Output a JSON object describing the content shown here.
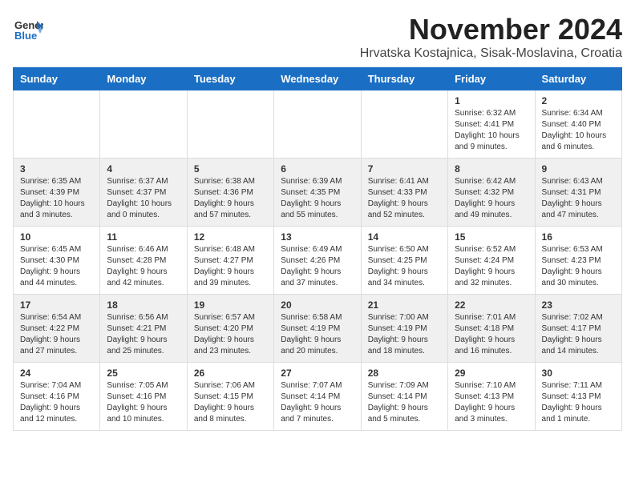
{
  "header": {
    "logo_general": "General",
    "logo_blue": "Blue",
    "month_title": "November 2024",
    "location": "Hrvatska Kostajnica, Sisak-Moslavina, Croatia"
  },
  "weekdays": [
    "Sunday",
    "Monday",
    "Tuesday",
    "Wednesday",
    "Thursday",
    "Friday",
    "Saturday"
  ],
  "weeks": [
    [
      {
        "day": "",
        "info": ""
      },
      {
        "day": "",
        "info": ""
      },
      {
        "day": "",
        "info": ""
      },
      {
        "day": "",
        "info": ""
      },
      {
        "day": "",
        "info": ""
      },
      {
        "day": "1",
        "info": "Sunrise: 6:32 AM\nSunset: 4:41 PM\nDaylight: 10 hours\nand 9 minutes."
      },
      {
        "day": "2",
        "info": "Sunrise: 6:34 AM\nSunset: 4:40 PM\nDaylight: 10 hours\nand 6 minutes."
      }
    ],
    [
      {
        "day": "3",
        "info": "Sunrise: 6:35 AM\nSunset: 4:39 PM\nDaylight: 10 hours\nand 3 minutes."
      },
      {
        "day": "4",
        "info": "Sunrise: 6:37 AM\nSunset: 4:37 PM\nDaylight: 10 hours\nand 0 minutes."
      },
      {
        "day": "5",
        "info": "Sunrise: 6:38 AM\nSunset: 4:36 PM\nDaylight: 9 hours\nand 57 minutes."
      },
      {
        "day": "6",
        "info": "Sunrise: 6:39 AM\nSunset: 4:35 PM\nDaylight: 9 hours\nand 55 minutes."
      },
      {
        "day": "7",
        "info": "Sunrise: 6:41 AM\nSunset: 4:33 PM\nDaylight: 9 hours\nand 52 minutes."
      },
      {
        "day": "8",
        "info": "Sunrise: 6:42 AM\nSunset: 4:32 PM\nDaylight: 9 hours\nand 49 minutes."
      },
      {
        "day": "9",
        "info": "Sunrise: 6:43 AM\nSunset: 4:31 PM\nDaylight: 9 hours\nand 47 minutes."
      }
    ],
    [
      {
        "day": "10",
        "info": "Sunrise: 6:45 AM\nSunset: 4:30 PM\nDaylight: 9 hours\nand 44 minutes."
      },
      {
        "day": "11",
        "info": "Sunrise: 6:46 AM\nSunset: 4:28 PM\nDaylight: 9 hours\nand 42 minutes."
      },
      {
        "day": "12",
        "info": "Sunrise: 6:48 AM\nSunset: 4:27 PM\nDaylight: 9 hours\nand 39 minutes."
      },
      {
        "day": "13",
        "info": "Sunrise: 6:49 AM\nSunset: 4:26 PM\nDaylight: 9 hours\nand 37 minutes."
      },
      {
        "day": "14",
        "info": "Sunrise: 6:50 AM\nSunset: 4:25 PM\nDaylight: 9 hours\nand 34 minutes."
      },
      {
        "day": "15",
        "info": "Sunrise: 6:52 AM\nSunset: 4:24 PM\nDaylight: 9 hours\nand 32 minutes."
      },
      {
        "day": "16",
        "info": "Sunrise: 6:53 AM\nSunset: 4:23 PM\nDaylight: 9 hours\nand 30 minutes."
      }
    ],
    [
      {
        "day": "17",
        "info": "Sunrise: 6:54 AM\nSunset: 4:22 PM\nDaylight: 9 hours\nand 27 minutes."
      },
      {
        "day": "18",
        "info": "Sunrise: 6:56 AM\nSunset: 4:21 PM\nDaylight: 9 hours\nand 25 minutes."
      },
      {
        "day": "19",
        "info": "Sunrise: 6:57 AM\nSunset: 4:20 PM\nDaylight: 9 hours\nand 23 minutes."
      },
      {
        "day": "20",
        "info": "Sunrise: 6:58 AM\nSunset: 4:19 PM\nDaylight: 9 hours\nand 20 minutes."
      },
      {
        "day": "21",
        "info": "Sunrise: 7:00 AM\nSunset: 4:19 PM\nDaylight: 9 hours\nand 18 minutes."
      },
      {
        "day": "22",
        "info": "Sunrise: 7:01 AM\nSunset: 4:18 PM\nDaylight: 9 hours\nand 16 minutes."
      },
      {
        "day": "23",
        "info": "Sunrise: 7:02 AM\nSunset: 4:17 PM\nDaylight: 9 hours\nand 14 minutes."
      }
    ],
    [
      {
        "day": "24",
        "info": "Sunrise: 7:04 AM\nSunset: 4:16 PM\nDaylight: 9 hours\nand 12 minutes."
      },
      {
        "day": "25",
        "info": "Sunrise: 7:05 AM\nSunset: 4:16 PM\nDaylight: 9 hours\nand 10 minutes."
      },
      {
        "day": "26",
        "info": "Sunrise: 7:06 AM\nSunset: 4:15 PM\nDaylight: 9 hours\nand 8 minutes."
      },
      {
        "day": "27",
        "info": "Sunrise: 7:07 AM\nSunset: 4:14 PM\nDaylight: 9 hours\nand 7 minutes."
      },
      {
        "day": "28",
        "info": "Sunrise: 7:09 AM\nSunset: 4:14 PM\nDaylight: 9 hours\nand 5 minutes."
      },
      {
        "day": "29",
        "info": "Sunrise: 7:10 AM\nSunset: 4:13 PM\nDaylight: 9 hours\nand 3 minutes."
      },
      {
        "day": "30",
        "info": "Sunrise: 7:11 AM\nSunset: 4:13 PM\nDaylight: 9 hours\nand 1 minute."
      }
    ]
  ]
}
